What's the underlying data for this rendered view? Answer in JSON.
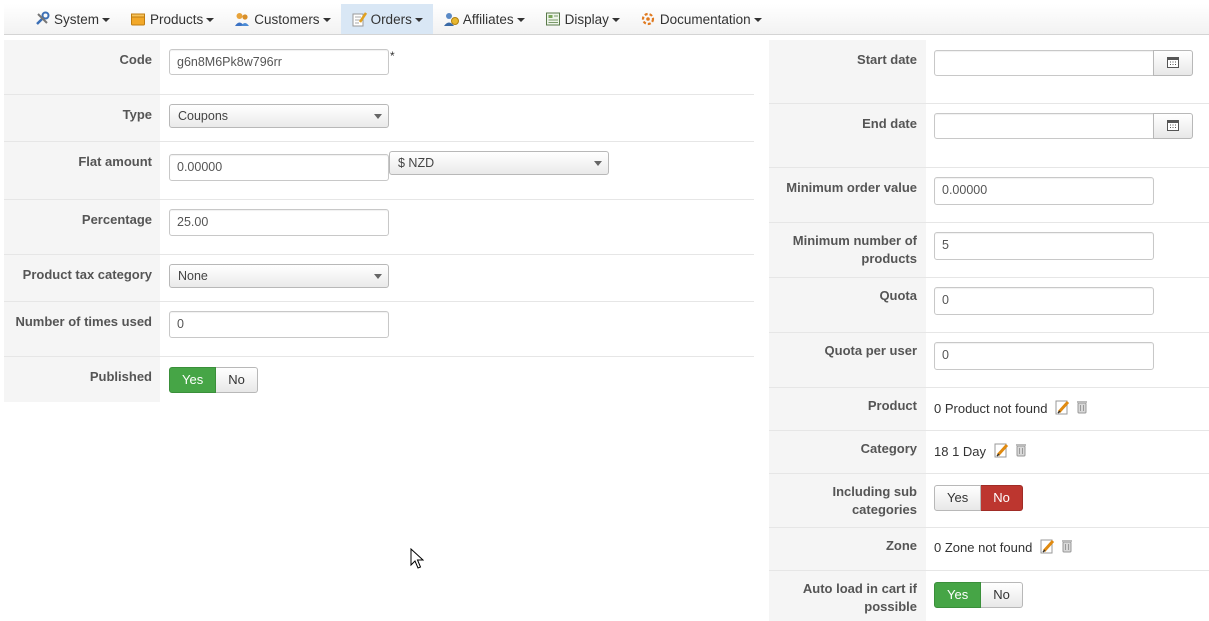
{
  "menu": {
    "items": [
      {
        "label": "System",
        "icon": "tools-icon"
      },
      {
        "label": "Products",
        "icon": "box-icon"
      },
      {
        "label": "Customers",
        "icon": "users-icon"
      },
      {
        "label": "Orders",
        "icon": "orders-icon",
        "active": true
      },
      {
        "label": "Affiliates",
        "icon": "affiliates-icon"
      },
      {
        "label": "Display",
        "icon": "display-icon"
      },
      {
        "label": "Documentation",
        "icon": "documentation-icon"
      }
    ]
  },
  "left": {
    "code": {
      "label": "Code",
      "value": "g6n8M6Pk8w796rr",
      "required": "*"
    },
    "type": {
      "label": "Type",
      "value": "Coupons"
    },
    "flat_amount": {
      "label": "Flat amount",
      "value": "0.00000",
      "currency": "$ NZD"
    },
    "percentage": {
      "label": "Percentage",
      "value": "25.00"
    },
    "tax_category": {
      "label": "Product tax category",
      "value": "None"
    },
    "times_used": {
      "label": "Number of times used",
      "value": "0"
    },
    "published": {
      "label": "Published",
      "yes": "Yes",
      "no": "No",
      "selected": "Yes"
    }
  },
  "right": {
    "start_date": {
      "label": "Start date",
      "value": ""
    },
    "end_date": {
      "label": "End date",
      "value": ""
    },
    "min_order_value": {
      "label": "Minimum order value",
      "value": "0.00000"
    },
    "min_products": {
      "label": "Minimum number of products",
      "value": "5"
    },
    "quota": {
      "label": "Quota",
      "value": "0"
    },
    "quota_per_user": {
      "label": "Quota per user",
      "value": "0"
    },
    "product": {
      "label": "Product",
      "value": "0 Product not found"
    },
    "category": {
      "label": "Category",
      "value": "18 1 Day"
    },
    "including_sub": {
      "label": "Including sub categories",
      "yes": "Yes",
      "no": "No",
      "selected": "No"
    },
    "zone": {
      "label": "Zone",
      "value": "0 Zone not found"
    },
    "auto_load": {
      "label": "Auto load in cart if possible",
      "yes": "Yes",
      "no": "No",
      "selected": "Yes"
    }
  },
  "colors": {
    "yes_active": "#46a546",
    "no_active": "#bd362f",
    "menu_active": "#d9e7f5"
  }
}
